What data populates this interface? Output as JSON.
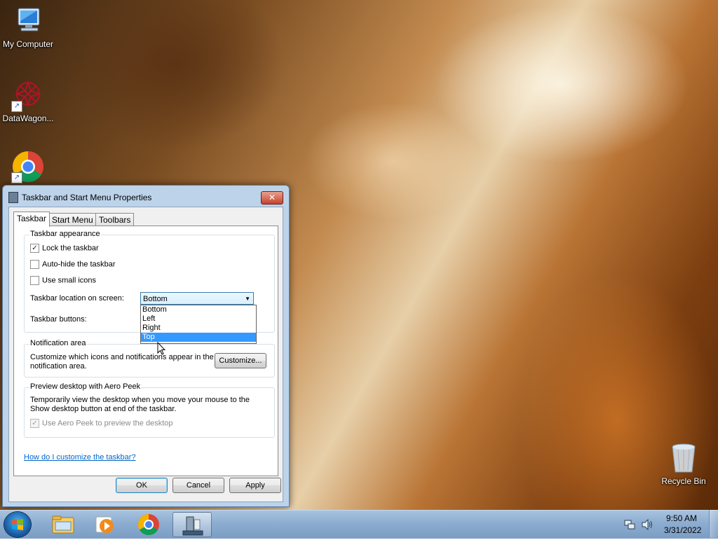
{
  "desktop": {
    "icons": [
      {
        "label": "My Computer"
      },
      {
        "label": "DataWagon..."
      },
      {
        "label": ""
      },
      {
        "label": "Recycle Bin"
      }
    ]
  },
  "dialog": {
    "title": "Taskbar and Start Menu Properties",
    "close_label": "✕",
    "tabs": [
      {
        "label": "Taskbar",
        "active": true
      },
      {
        "label": "Start Menu",
        "active": false
      },
      {
        "label": "Toolbars",
        "active": false
      }
    ],
    "appearance": {
      "title": "Taskbar appearance",
      "lock_label": "Lock the taskbar",
      "lock_checked": true,
      "autohide_label": "Auto-hide the taskbar",
      "autohide_checked": false,
      "small_icons_label": "Use small icons",
      "small_icons_checked": false,
      "location_label": "Taskbar location on screen:",
      "location_value": "Bottom",
      "location_options": [
        "Bottom",
        "Left",
        "Right",
        "Top"
      ],
      "location_highlighted": "Top",
      "buttons_label": "Taskbar buttons:"
    },
    "notification": {
      "title": "Notification area",
      "text": "Customize which icons and notifications appear in the notification area.",
      "customize_label": "Customize..."
    },
    "peek": {
      "title": "Preview desktop with Aero Peek",
      "text": "Temporarily view the desktop when you move your mouse to the Show desktop button at end of the taskbar.",
      "checkbox_label": "Use Aero Peek to preview the desktop",
      "checked": true
    },
    "help_link": "How do I customize the taskbar?",
    "ok_label": "OK",
    "cancel_label": "Cancel",
    "apply_label": "Apply"
  },
  "taskbar": {
    "apps": [
      {
        "icon": "windows-explorer-icon"
      },
      {
        "icon": "media-player-icon"
      },
      {
        "icon": "chrome-icon"
      },
      {
        "icon": "taskbar-properties-icon",
        "active": true
      }
    ],
    "clock_time": "9:50 AM",
    "clock_date": "3/31/2022"
  },
  "colors": {
    "selection": "#3399ff",
    "link": "#0066cc",
    "close_button": "#c7432c"
  }
}
